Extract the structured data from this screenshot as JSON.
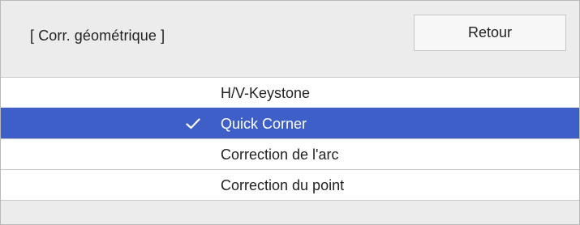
{
  "dialog": {
    "title": "[ Corr. géométrique ]",
    "back_label": "Retour"
  },
  "menu": {
    "items": [
      {
        "label": "H/V-Keystone",
        "selected": false
      },
      {
        "label": "Quick Corner",
        "selected": true
      },
      {
        "label": "Correction de l'arc",
        "selected": false
      },
      {
        "label": "Correction du point",
        "selected": false
      }
    ]
  },
  "colors": {
    "selected_bg": "#3f5fc8",
    "selected_text": "#ffffff",
    "panel_bg": "#ececec"
  }
}
